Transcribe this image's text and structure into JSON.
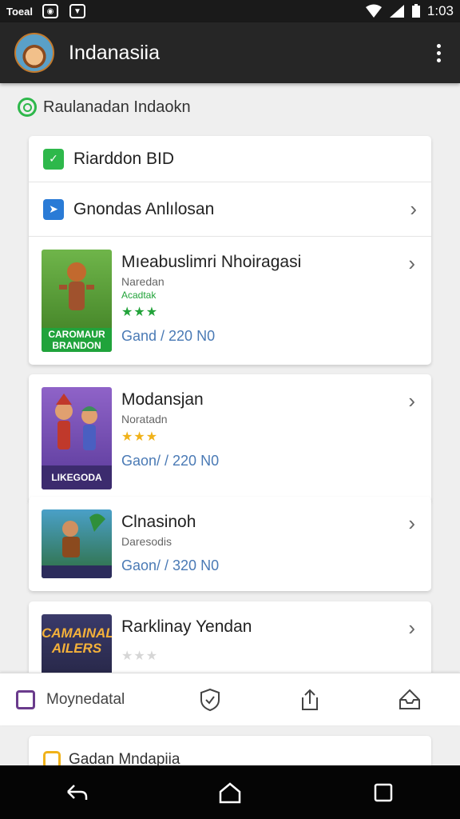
{
  "status_bar": {
    "carrier": "Toeal",
    "time": "1:03"
  },
  "app_bar": {
    "title": "Indanasiia"
  },
  "section": {
    "title": "Raulanadan Indaokn"
  },
  "top_card": {
    "rows": [
      {
        "label": "Riarddon BID",
        "icon_color": "#2eb84b"
      },
      {
        "label": "Gnondas Anlılosan",
        "icon_color": "#2a7bd6"
      }
    ]
  },
  "games": [
    {
      "title": "Mıeabuslimri Nhoiragasi",
      "subtitle": "Naredan",
      "tag": "Acadtak",
      "stars": "★★★",
      "stars_color": "#22a33a",
      "price": "Gand / 220 N0",
      "caption": "CAROMAUR BRANDON",
      "caption_bg": "#20a33b",
      "art_bg": "#4f9a2f"
    },
    {
      "title": "Modansjan",
      "subtitle": "Noratadn",
      "stars": "★★★",
      "stars_color": "#f0b21a",
      "price": "Gaon/ / 220 N0",
      "caption": "LIKEGODA",
      "caption_bg": "#3c2b6e",
      "art_bg": "#7b4aa8"
    },
    {
      "title": "Clnasinoh",
      "subtitle": "Daresodis",
      "stars": "",
      "price": "Gaon/ / 320 N0",
      "caption": "",
      "caption_bg": "#2c2c5c",
      "art_bg": "#3c8f6f"
    },
    {
      "title": "Rarklinay Yendan",
      "subtitle": "",
      "stars": "★★★",
      "stars_color": "#d6d6d6",
      "price": "",
      "caption": "CAMAINAL AILERS",
      "caption_bg": "#6b3a18",
      "art_bg": "#2a2a4a"
    }
  ],
  "bottom_sheet": {
    "label": "Moynedatal"
  },
  "peek_card": {
    "label": "Gadan Mndapiia"
  }
}
